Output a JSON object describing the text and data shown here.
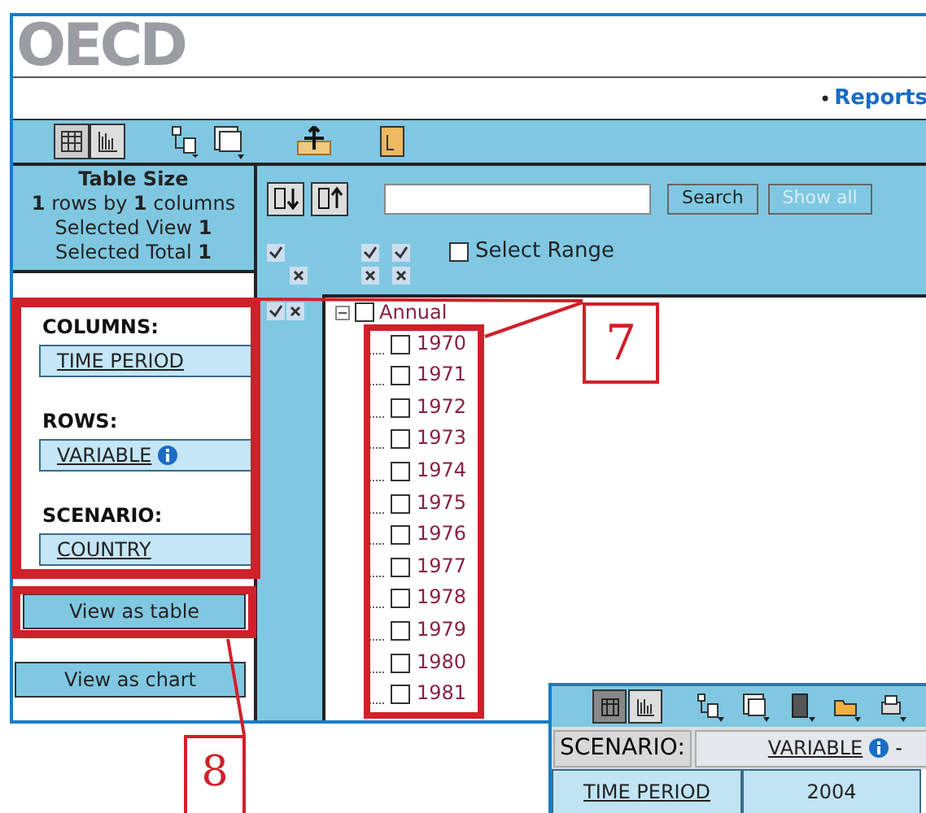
{
  "header": {
    "logo": "OECD",
    "links": [
      {
        "bullet": "•",
        "label": "Reports"
      }
    ]
  },
  "table_size": {
    "title": "Table Size",
    "lines": [
      "**1** rows by **1** columns",
      "Selected View **1**",
      "Selected Total **1**"
    ]
  },
  "layout": [
    {
      "heading": "COLUMNS:",
      "dimension": "TIME PERIOD",
      "info": false
    },
    {
      "heading": "ROWS:",
      "dimension": "VARIABLE",
      "info": true
    },
    {
      "heading": "SCENARIO:",
      "dimension": "COUNTRY",
      "info": false
    }
  ],
  "view_buttons": [
    "View as table",
    "View as chart"
  ],
  "search": {
    "buttons": [
      {
        "label": "Search",
        "disabled": false
      },
      {
        "label": "Show all",
        "disabled": true
      }
    ]
  },
  "select_range": {
    "label": "Select Range",
    "checked": false
  },
  "tree": {
    "label": "Annual",
    "checked": false,
    "expanded": true,
    "children": [
      {
        "label": "1970",
        "checked": false
      },
      {
        "label": "1971",
        "checked": false
      },
      {
        "label": "1972",
        "checked": false
      },
      {
        "label": "1973",
        "checked": false
      },
      {
        "label": "1974",
        "checked": false
      },
      {
        "label": "1975",
        "checked": false
      },
      {
        "label": "1976",
        "checked": false
      },
      {
        "label": "1977",
        "checked": false
      },
      {
        "label": "1978",
        "checked": false
      },
      {
        "label": "1979",
        "checked": false
      },
      {
        "label": "1980",
        "checked": false
      },
      {
        "label": "1981",
        "checked": false
      }
    ]
  },
  "callouts": [
    "7",
    "8"
  ],
  "table_window": {
    "view_modes": [
      {
        "selected": true
      },
      {
        "selected": false
      }
    ],
    "scenario_label": "SCENARIO:",
    "scenario_value": "VARIABLE",
    "scenario_info": true,
    "separator": "-",
    "row_header": "TIME PERIOD",
    "column": "2004"
  }
}
